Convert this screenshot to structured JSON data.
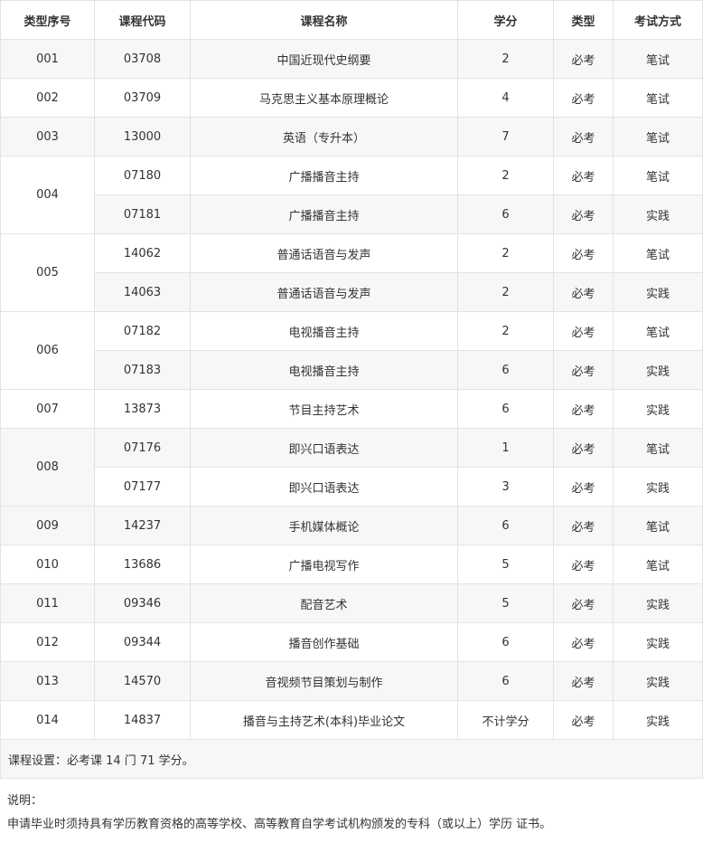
{
  "headers": [
    "类型序号",
    "课程代码",
    "课程名称",
    "学分",
    "类型",
    "考试方式"
  ],
  "groups": [
    {
      "no": "001",
      "rows": [
        {
          "code": "03708",
          "name": "中国近现代史纲要",
          "credit": "2",
          "type": "必考",
          "exam": "笔试"
        }
      ]
    },
    {
      "no": "002",
      "rows": [
        {
          "code": "03709",
          "name": "马克思主义基本原理概论",
          "credit": "4",
          "type": "必考",
          "exam": "笔试"
        }
      ]
    },
    {
      "no": "003",
      "rows": [
        {
          "code": "13000",
          "name": "英语（专升本）",
          "credit": "7",
          "type": "必考",
          "exam": "笔试"
        }
      ]
    },
    {
      "no": "004",
      "rows": [
        {
          "code": "07180",
          "name": "广播播音主持",
          "credit": "2",
          "type": "必考",
          "exam": "笔试"
        },
        {
          "code": "07181",
          "name": "广播播音主持",
          "credit": "6",
          "type": "必考",
          "exam": "实践"
        }
      ]
    },
    {
      "no": "005",
      "rows": [
        {
          "code": "14062",
          "name": "普通话语音与发声",
          "credit": "2",
          "type": "必考",
          "exam": "笔试"
        },
        {
          "code": "14063",
          "name": "普通话语音与发声",
          "credit": "2",
          "type": "必考",
          "exam": "实践"
        }
      ]
    },
    {
      "no": "006",
      "rows": [
        {
          "code": "07182",
          "name": "电视播音主持",
          "credit": "2",
          "type": "必考",
          "exam": "笔试"
        },
        {
          "code": "07183",
          "name": "电视播音主持",
          "credit": "6",
          "type": "必考",
          "exam": "实践"
        }
      ]
    },
    {
      "no": "007",
      "rows": [
        {
          "code": "13873",
          "name": "节目主持艺术",
          "credit": "6",
          "type": "必考",
          "exam": "实践"
        }
      ]
    },
    {
      "no": "008",
      "rows": [
        {
          "code": "07176",
          "name": "即兴口语表达",
          "credit": "1",
          "type": "必考",
          "exam": "笔试"
        },
        {
          "code": "07177",
          "name": "即兴口语表达",
          "credit": "3",
          "type": "必考",
          "exam": "实践"
        }
      ]
    },
    {
      "no": "009",
      "rows": [
        {
          "code": "14237",
          "name": "手机媒体概论",
          "credit": "6",
          "type": "必考",
          "exam": "笔试"
        }
      ]
    },
    {
      "no": "010",
      "rows": [
        {
          "code": "13686",
          "name": "广播电视写作",
          "credit": "5",
          "type": "必考",
          "exam": "笔试"
        }
      ]
    },
    {
      "no": "011",
      "rows": [
        {
          "code": "09346",
          "name": "配音艺术",
          "credit": "5",
          "type": "必考",
          "exam": "实践"
        }
      ]
    },
    {
      "no": "012",
      "rows": [
        {
          "code": "09344",
          "name": "播音创作基础",
          "credit": "6",
          "type": "必考",
          "exam": "实践"
        }
      ]
    },
    {
      "no": "013",
      "rows": [
        {
          "code": "14570",
          "name": "音视频节目策划与制作",
          "credit": "6",
          "type": "必考",
          "exam": "实践"
        }
      ]
    },
    {
      "no": "014",
      "rows": [
        {
          "code": "14837",
          "name": "播音与主持艺术(本科)毕业论文",
          "credit": "不计学分",
          "type": "必考",
          "exam": "实践"
        }
      ]
    }
  ],
  "summary": "课程设置：必考课 14 门 71 学分。",
  "notes_title": "说明：",
  "notes_body": "申请毕业时须持具有学历教育资格的高等学校、高等教育自学考试机构颁发的专科（或以上）学历 证书。"
}
